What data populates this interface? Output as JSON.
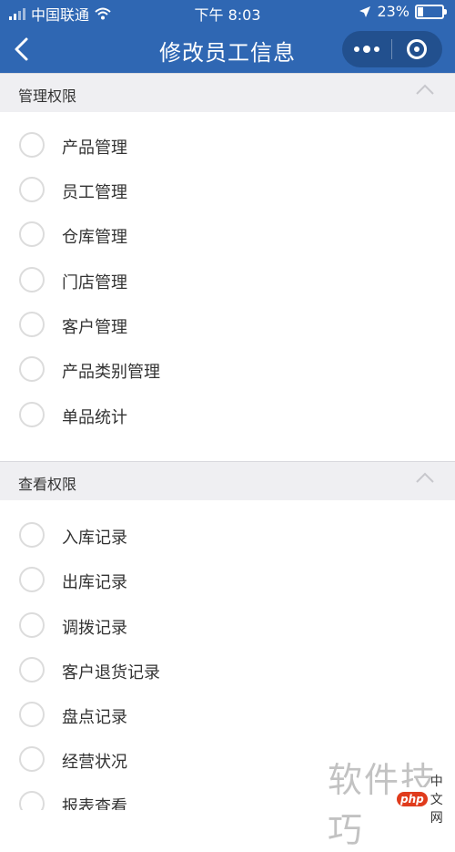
{
  "status_bar": {
    "carrier": "中国联通",
    "time": "下午 8:03",
    "battery": "23%"
  },
  "nav": {
    "title": "修改员工信息"
  },
  "sections": [
    {
      "title": "管理权限",
      "items": [
        "产品管理",
        "员工管理",
        "仓库管理",
        "门店管理",
        "客户管理",
        "产品类别管理",
        "单品统计"
      ]
    },
    {
      "title": "查看权限",
      "items": [
        "入库记录",
        "出库记录",
        "调拨记录",
        "客户退货记录",
        "盘点记录",
        "经营状况",
        "报表查看"
      ]
    }
  ],
  "watermark": {
    "text": "软件技巧",
    "badge_logo": "php",
    "badge_text": "中文网"
  }
}
